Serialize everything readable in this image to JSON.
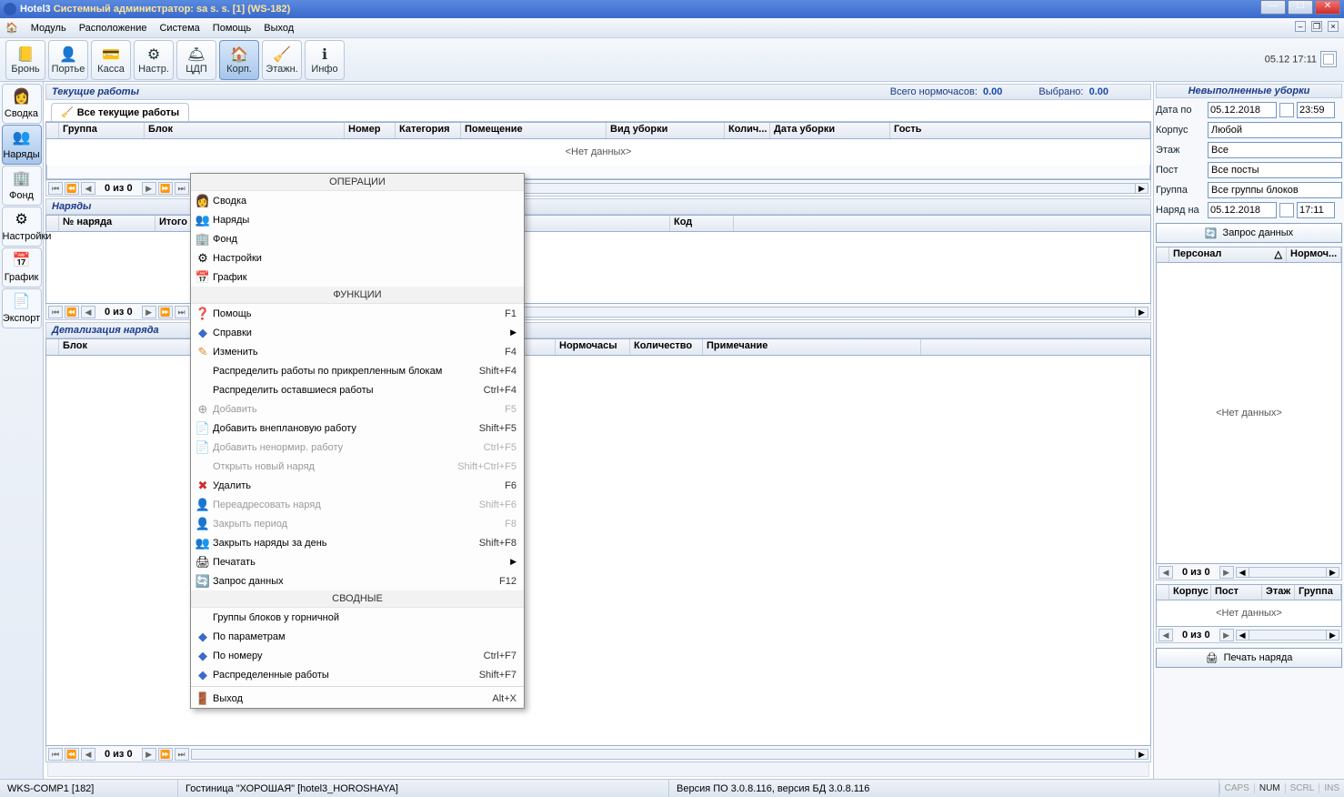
{
  "window": {
    "title_pre": "Hotel3 ",
    "title_rest": "Системный администратор: sa s. s. [1] (WS-182)"
  },
  "menubar": {
    "home": "",
    "items": [
      "Модуль",
      "Расположение",
      "Система",
      "Помощь",
      "Выход"
    ]
  },
  "toolbar": [
    {
      "label": "Бронь",
      "icon": "📒"
    },
    {
      "label": "Портье",
      "icon": "👤"
    },
    {
      "label": "Касса",
      "icon": "💳"
    },
    {
      "label": "Настр.",
      "icon": "⚙"
    },
    {
      "label": "ЦДП",
      "icon": "🛎"
    },
    {
      "label": "Корп.",
      "icon": "🏠",
      "active": true
    },
    {
      "label": "Этажн.",
      "icon": "🧹"
    },
    {
      "label": "Инфо",
      "icon": "ℹ"
    }
  ],
  "datetime_text": "05.12  17:11",
  "sidebar": [
    {
      "label": "Сводка",
      "icon": "👩"
    },
    {
      "label": "Наряды",
      "icon": "👥",
      "active": true
    },
    {
      "label": "Фонд",
      "icon": "🏢"
    },
    {
      "label": "Настройки",
      "icon": "⚙"
    },
    {
      "label": "График",
      "icon": "📅"
    },
    {
      "label": "Экспорт",
      "icon": "📄"
    }
  ],
  "panels": {
    "current": {
      "title": "Текущие работы",
      "total_label": "Всего нормочасов:",
      "total_val": "0.00",
      "sel_label": "Выбрано:",
      "sel_val": "0.00",
      "tab": "Все текущие работы",
      "cols": [
        "Группа",
        "Блок",
        "Номер",
        "Категория",
        "Помещение",
        "Вид уборки",
        "Колич...",
        "Дата уборки",
        "Гость"
      ],
      "empty": "<Нет данных>",
      "nav": "0 из 0"
    },
    "orders": {
      "title": "Наряды",
      "cols": [
        "№ наряда",
        "Итого",
        "Код"
      ],
      "nav": "0 из 0"
    },
    "detail": {
      "title": "Детализация наряда",
      "cols": [
        "Блок",
        "Нормочасы",
        "Количество",
        "Примечание"
      ],
      "nav": "0 из 0"
    }
  },
  "right": {
    "title": "Невыполненные уборки",
    "date_to_lbl": "Дата по",
    "date_to": "05.12.2018",
    "time_to": "23:59",
    "korpus_lbl": "Корпус",
    "korpus": "Любой",
    "floor_lbl": "Этаж",
    "floor": "Все",
    "post_lbl": "Пост",
    "post": "Все посты",
    "group_lbl": "Группа",
    "group": "Все группы блоков",
    "order_at_lbl": "Наряд на",
    "order_date": "05.12.2018",
    "order_time": "17:11",
    "request_btn": "Запрос данных",
    "grid1_cols": [
      "Персонал",
      "Нормоч..."
    ],
    "grid1_empty": "<Нет данных>",
    "grid1_nav": "0 из 0",
    "grid2_cols": [
      "Корпус",
      "Пост",
      "Этаж",
      "Группа"
    ],
    "grid2_empty": "<Нет данных>",
    "grid2_nav": "0 из 0",
    "print_btn": "Печать наряда"
  },
  "context_menu": {
    "sec1": "ОПЕРАЦИИ",
    "ops": [
      {
        "label": "Сводка",
        "icon": "👩"
      },
      {
        "label": "Наряды",
        "icon": "👥"
      },
      {
        "label": "Фонд",
        "icon": "🏢"
      },
      {
        "label": "Настройки",
        "icon": "⚙"
      },
      {
        "label": "График",
        "icon": "📅"
      }
    ],
    "sec2": "ФУНКЦИИ",
    "funcs": [
      {
        "label": "Помощь",
        "icon": "❓",
        "sc": "F1"
      },
      {
        "label": "Справки",
        "icon": "◆",
        "submenu": true
      },
      {
        "label": "Изменить",
        "icon": "✎",
        "sc": "F4"
      },
      {
        "label": "Распределить работы по прикрепленным блокам",
        "sc": "Shift+F4"
      },
      {
        "label": "Распределить оставшиеся работы",
        "sc": "Ctrl+F4"
      },
      {
        "label": "Добавить",
        "icon": "⊕",
        "sc": "F5",
        "disabled": true
      },
      {
        "label": "Добавить внеплановую работу",
        "icon": "📄",
        "sc": "Shift+F5"
      },
      {
        "label": "Добавить ненормир. работу",
        "icon": "📄",
        "sc": "Ctrl+F5",
        "disabled": true
      },
      {
        "label": "Открыть новый наряд",
        "sc": "Shift+Ctrl+F5",
        "disabled": true
      },
      {
        "label": "Удалить",
        "icon": "✖",
        "sc": "F6"
      },
      {
        "label": "Переадресовать наряд",
        "icon": "👤",
        "sc": "Shift+F6",
        "disabled": true
      },
      {
        "label": "Закрыть период",
        "icon": "👤",
        "sc": "F8",
        "disabled": true
      },
      {
        "label": "Закрыть наряды за день",
        "icon": "👥",
        "sc": "Shift+F8"
      },
      {
        "label": "Печатать",
        "icon": "🖨",
        "submenu": true
      },
      {
        "label": "Запрос данных",
        "icon": "🔄",
        "sc": "F12"
      }
    ],
    "sec3": "СВОДНЫЕ",
    "summaries": [
      {
        "label": "Группы блоков у  горничной"
      },
      {
        "label": "По параметрам",
        "icon": "◆"
      },
      {
        "label": "По номеру",
        "icon": "◆",
        "sc": "Ctrl+F7"
      },
      {
        "label": "Распределенные работы",
        "icon": "◆",
        "sc": "Shift+F7"
      }
    ],
    "exit": {
      "label": "Выход",
      "icon": "🚪",
      "sc": "Alt+X"
    }
  },
  "statusbar": {
    "ws": "WKS-COMP1 [182]",
    "hotel": "Гостиница \"ХОРОШАЯ\" [hotel3_HOROSHAYA]",
    "version": "Версия ПО 3.0.8.116, версия БД 3.0.8.116",
    "caps": "CAPS",
    "num": "NUM",
    "scrl": "SCRL",
    "ins": "INS"
  }
}
